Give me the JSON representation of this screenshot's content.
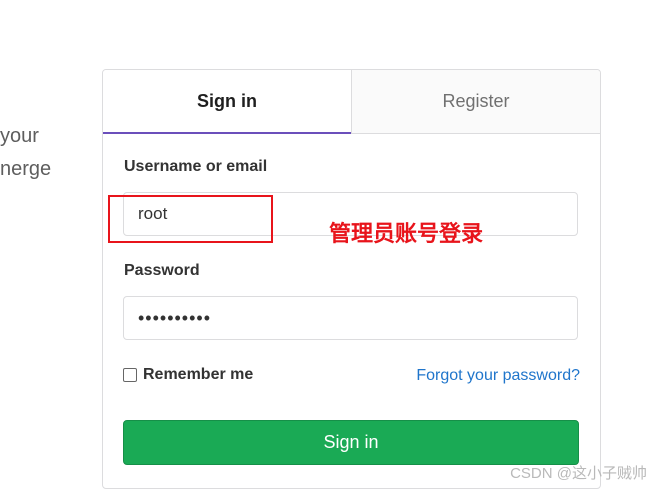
{
  "left_text": {
    "line1": "your",
    "line2": "nerge"
  },
  "tabs": [
    {
      "label": "Sign in",
      "active": true
    },
    {
      "label": "Register",
      "active": false
    }
  ],
  "form": {
    "username_label": "Username or email",
    "username_value": "root",
    "password_label": "Password",
    "password_value": "••••••••••",
    "remember_label": "Remember me",
    "remember_checked": false,
    "forgot_link": "Forgot your password?",
    "submit_label": "Sign in"
  },
  "annotation": {
    "text": "管理员账号登录",
    "color": "#e8141b"
  },
  "watermark": "CSDN @这小子贼帅",
  "colors": {
    "primary_button": "#1aaa55",
    "active_tab_underline": "#6b4fbb",
    "link": "#1f75cb"
  }
}
